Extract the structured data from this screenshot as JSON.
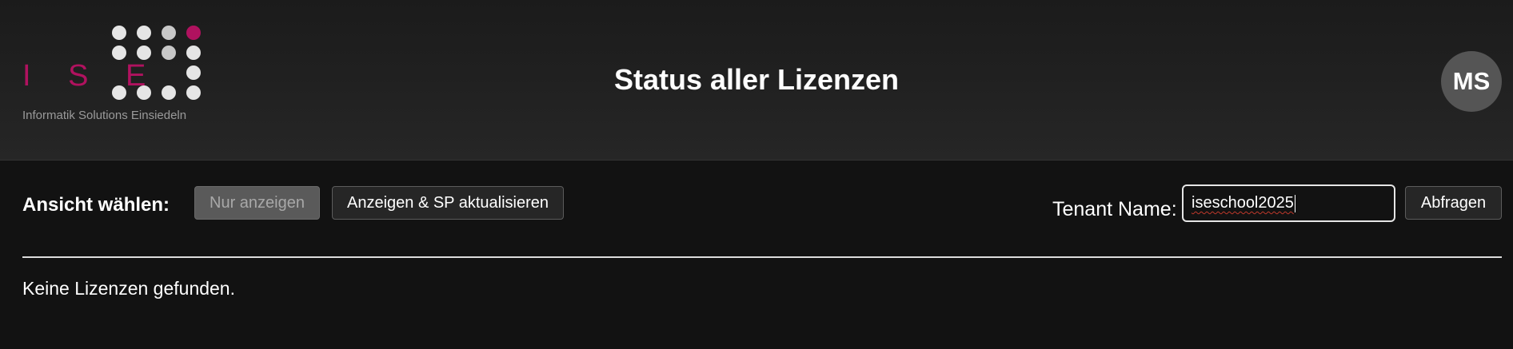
{
  "header": {
    "logo": {
      "letters": "I S E",
      "tagline": "Informatik Solutions Einsiedeln",
      "colors": {
        "accent": "#b0125f",
        "light": "#e5e5e5",
        "mid": "#c8c8c8"
      }
    },
    "title": "Status aller Lizenzen",
    "avatar_initials": "MS"
  },
  "toolbar": {
    "view_label": "Ansicht wählen:",
    "view_only_label": "Nur anzeigen",
    "view_update_label": "Anzeigen & SP aktualisieren",
    "tenant_label": "Tenant Name:",
    "tenant_value": "iseschool2025",
    "query_label": "Abfragen"
  },
  "main": {
    "empty_message": "Keine Lizenzen gefunden."
  }
}
